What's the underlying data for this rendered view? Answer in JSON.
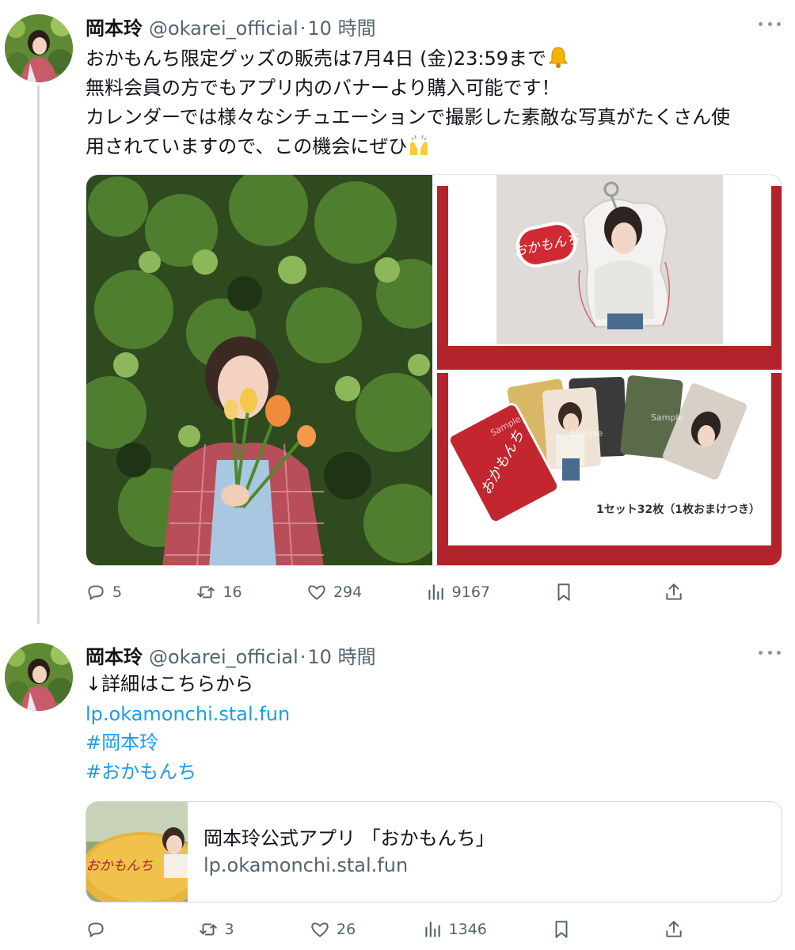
{
  "tweets": [
    {
      "author": {
        "name": "岡本玲",
        "handle": "@okarei_official",
        "separator": "·",
        "time": "10 時間"
      },
      "lines": [
        "おかもんち限定グッズの販売は7月4日 (金)23:59まで",
        "無料会員の方でもアプリ内のバナーより購入可能です！",
        "カレンダーでは様々なシチュエーションで撮影した素敵な写真がたくさん使",
        "用されていますので、この機会にぜひ"
      ],
      "emojis": [
        "bell-emoji",
        "raising-hands-emoji"
      ],
      "media": {
        "keychain_text": "おかもんち",
        "card_text": "おかもんち",
        "sample_watermark": "Sample",
        "card_set_caption": "1セット32枚（1枚おまけつき）"
      },
      "actions": {
        "replies": "5",
        "retweets": "16",
        "likes": "294",
        "views": "9167"
      }
    },
    {
      "author": {
        "name": "岡本玲",
        "handle": "@okarei_official",
        "separator": "·",
        "time": "10 時間"
      },
      "lines": [
        "↓詳細はこちらから"
      ],
      "link": "lp.okamonchi.stal.fun",
      "hashtags": [
        "#岡本玲",
        "#おかもんち"
      ],
      "card": {
        "thumb_logo": "おかもんち",
        "title": "岡本玲公式アプリ 「おかもんち」",
        "domain": "lp.okamonchi.stal.fun"
      },
      "actions": {
        "replies": "",
        "retweets": "3",
        "likes": "26",
        "views": "1346"
      }
    }
  ],
  "colors": {
    "accent": "#1d9bf0",
    "muted": "#536471",
    "brand_red": "#b3232b"
  }
}
